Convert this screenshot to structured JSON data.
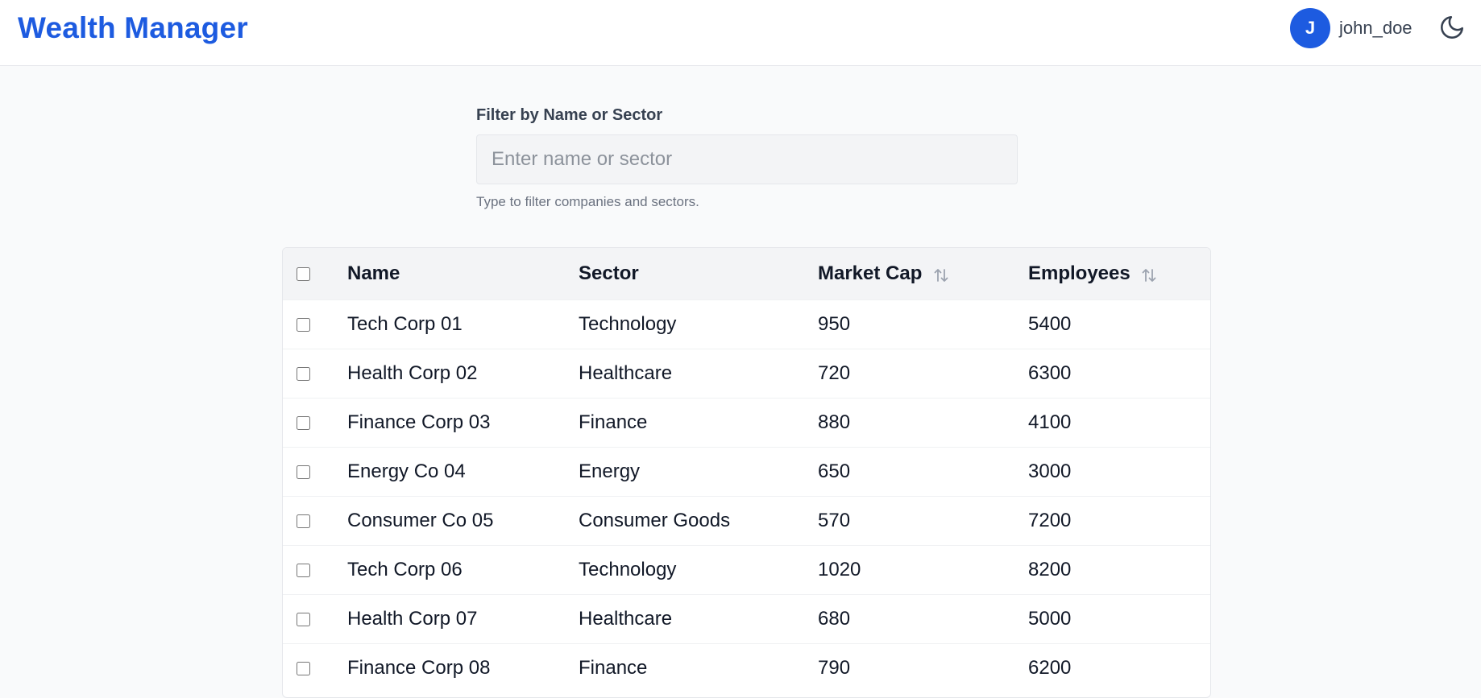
{
  "header": {
    "brand": "Wealth Manager",
    "user": {
      "avatar_initial": "J",
      "username": "john_doe"
    },
    "theme_toggle_icon": "moon-icon"
  },
  "filter": {
    "label": "Filter by Name or Sector",
    "placeholder": "Enter name or sector",
    "value": "",
    "help": "Type to filter companies and sectors."
  },
  "table": {
    "columns": {
      "name": "Name",
      "sector": "Sector",
      "market_cap": "Market Cap",
      "employees": "Employees"
    },
    "sortable_icon": "sort-arrows-icon",
    "rows": [
      {
        "name": "Tech Corp 01",
        "sector": "Technology",
        "market_cap": "950",
        "employees": "5400"
      },
      {
        "name": "Health Corp 02",
        "sector": "Healthcare",
        "market_cap": "720",
        "employees": "6300"
      },
      {
        "name": "Finance Corp 03",
        "sector": "Finance",
        "market_cap": "880",
        "employees": "4100"
      },
      {
        "name": "Energy Co 04",
        "sector": "Energy",
        "market_cap": "650",
        "employees": "3000"
      },
      {
        "name": "Consumer Co 05",
        "sector": "Consumer Goods",
        "market_cap": "570",
        "employees": "7200"
      },
      {
        "name": "Tech Corp 06",
        "sector": "Technology",
        "market_cap": "1020",
        "employees": "8200"
      },
      {
        "name": "Health Corp 07",
        "sector": "Healthcare",
        "market_cap": "680",
        "employees": "5000"
      },
      {
        "name": "Finance Corp 08",
        "sector": "Finance",
        "market_cap": "790",
        "employees": "6200"
      }
    ]
  },
  "colors": {
    "brand": "#1d5be0",
    "page_background": "#f9fafb",
    "header_background": "#ffffff",
    "table_header_background": "#f3f4f6"
  }
}
